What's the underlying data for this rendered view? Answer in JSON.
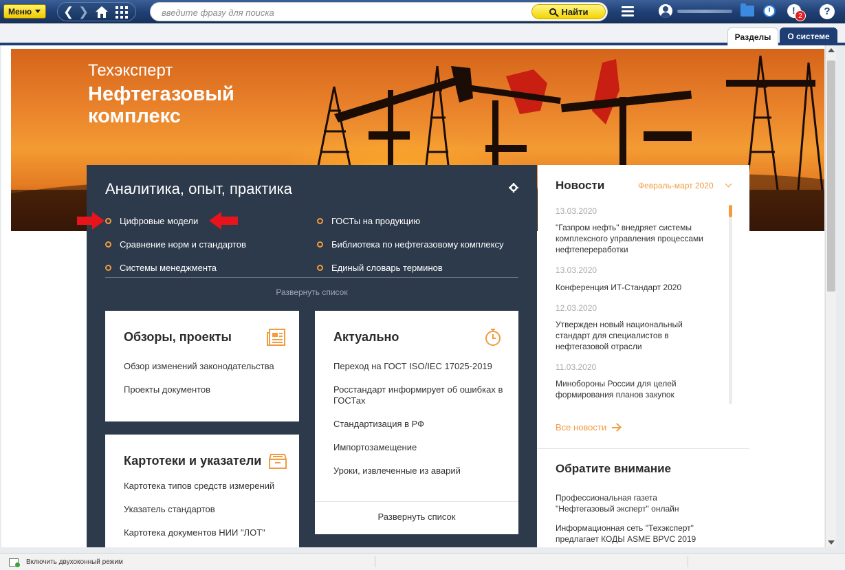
{
  "toolbar": {
    "menu_label": "Меню",
    "search_placeholder": "введите фразу для поиска",
    "find_label": "Найти",
    "alerts_count": "2"
  },
  "tabs": {
    "sections": "Разделы",
    "about": "О системе"
  },
  "hero": {
    "brand": "Техэксперт",
    "title": "Нефтегазовый комплекс"
  },
  "analytics": {
    "title": "Аналитика, опыт, практика",
    "links_left": [
      "Цифровые модели",
      "Сравнение норм и стандартов",
      "Системы менеджмента"
    ],
    "links_right": [
      "ГОСТы на продукцию",
      "Библиотека по нефтегазовому комплексу",
      "Единый словарь терминов"
    ],
    "expand": "Развернуть список"
  },
  "reviews": {
    "title": "Обзоры, проекты",
    "items": [
      "Обзор изменений законодательства",
      "Проекты документов"
    ]
  },
  "actual": {
    "title": "Актуально",
    "items": [
      "Переход на ГОСТ ISO/IEC 17025-2019",
      "Росстандарт информирует об ошибках в ГОСТах",
      "Стандартизация в РФ",
      "Импортозамещение",
      "Уроки, извлеченные из аварий"
    ],
    "expand": "Развернуть список"
  },
  "catalogs": {
    "title": "Картотеки и указатели",
    "items": [
      "Картотека типов средств измерений",
      "Указатель стандартов",
      "Картотека документов НИИ \"ЛОТ\""
    ]
  },
  "news": {
    "title": "Новости",
    "period": "Февраль-март 2020",
    "items": [
      {
        "date": "13.03.2020",
        "text": "\"Газпром нефть\" внедряет системы комплексного управления процессами нефтепереработки"
      },
      {
        "date": "13.03.2020",
        "text": "Конференция ИТ-Стандарт 2020"
      },
      {
        "date": "12.03.2020",
        "text": "Утвержден новый национальный стандарт для специалистов в нефтегазовой отрасли"
      },
      {
        "date": "11.03.2020",
        "text": "Минобороны России для целей формирования планов закупок"
      }
    ],
    "all_news": "Все новости"
  },
  "attention": {
    "title": "Обратите внимание",
    "items": [
      "Профессиональная газета \"Нефтегазовый эксперт\" онлайн",
      "Информационная сеть \"Техэксперт\" предлагает КОДЫ ASME BPVC 2019"
    ]
  },
  "statusbar": {
    "dual_window": "Включить двухоконный режим"
  },
  "colors": {
    "accent": "#f29b3f",
    "panel_dark": "#2d3a4c",
    "toolbar_blue": "#1f3e74",
    "find_yellow": "#f3d400",
    "red_arrow": "#e8141b"
  }
}
